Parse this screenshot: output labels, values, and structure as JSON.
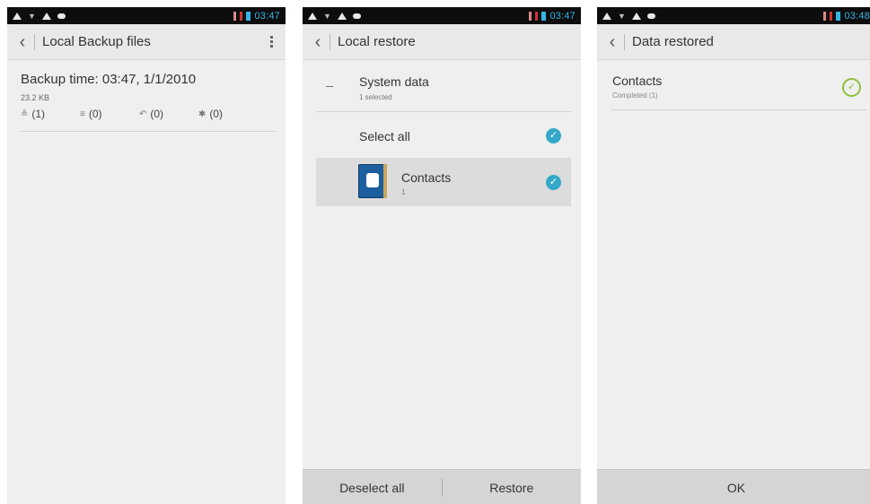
{
  "screens": [
    {
      "status": {
        "time": "03:47"
      },
      "title": "Local Backup files",
      "backup": {
        "time_label": "Backup time: 03:47, 1/1/2010",
        "size": "23.2 KB",
        "stats": [
          {
            "icon": "contacts-icon",
            "value": "(1)"
          },
          {
            "icon": "messages-icon",
            "value": "(0)"
          },
          {
            "icon": "call-log-icon",
            "value": "(0)"
          },
          {
            "icon": "apps-icon",
            "value": "(0)"
          }
        ]
      }
    },
    {
      "status": {
        "time": "03:47"
      },
      "title": "Local restore",
      "group": {
        "title": "System data",
        "subtitle": "1 selected"
      },
      "select_all": "Select all",
      "item": {
        "name": "Contacts",
        "count": "1"
      },
      "buttons": {
        "deselect": "Deselect all",
        "restore": "Restore"
      }
    },
    {
      "status": {
        "time": "03:48"
      },
      "title": "Data restored",
      "result": {
        "title": "Contacts",
        "status": "Completed (1)"
      },
      "button": "OK"
    }
  ],
  "colors": {
    "accent": "#33b5e5",
    "check": "#33a8c8",
    "success": "#8fbf3a"
  }
}
